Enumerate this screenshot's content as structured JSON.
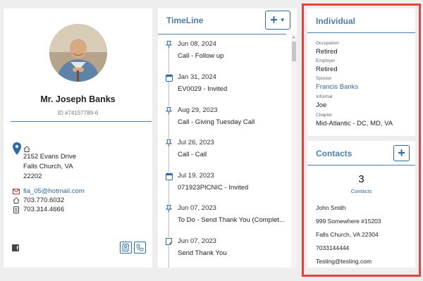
{
  "profile": {
    "name": "Mr. Joseph Banks",
    "id": "ID #74157789-6",
    "address_lines": [
      "2152 Evans Drive",
      "Falls Church, VA",
      "22202"
    ],
    "email": "fia_05@hotmail.com",
    "home_phone": "703.770.6032",
    "mobile_phone": "703.314.4666"
  },
  "timeline": {
    "title": "TimeLine",
    "add_label": "+",
    "items": [
      {
        "icon": "pin-icon",
        "date": "Jun 08, 2024",
        "text": "Call - Follow up"
      },
      {
        "icon": "calendar-icon",
        "date": "Jan 31, 2024",
        "text": "EV0029 - Invited"
      },
      {
        "icon": "pin-icon",
        "date": "Aug 29, 2023",
        "text": "Call - Giving Tuesday Call"
      },
      {
        "icon": "pin-icon",
        "date": "Jul 26, 2023",
        "text": "Call - Call"
      },
      {
        "icon": "calendar-icon",
        "date": "Jul 19, 2023",
        "text": "071923PICNIC - Invited"
      },
      {
        "icon": "pin-icon",
        "date": "Jun 07, 2023",
        "text": "To Do - Send Thank You (Complet..."
      },
      {
        "icon": "note-icon",
        "date": "Jun 07, 2023",
        "text": "Send Thank You"
      }
    ]
  },
  "individual": {
    "title": "Individual",
    "fields": [
      {
        "label": "Occupation",
        "value": "Retired",
        "link": false
      },
      {
        "label": "Employer",
        "value": "Retired",
        "link": false
      },
      {
        "label": "Spouse",
        "value": "Francis Banks",
        "link": true
      },
      {
        "label": "Informal",
        "value": "Joe",
        "link": false
      },
      {
        "label": "Chapter",
        "value": "Mid-Atlantic - DC, MD, VA",
        "link": false
      }
    ]
  },
  "contacts": {
    "title": "Contacts",
    "add_label": "+",
    "count": "3",
    "count_label": "Contacts",
    "lines": [
      "John Smith",
      "999 Somewhere #15203",
      "Falls Church, VA 22304",
      "7033144444",
      "Testing@testing.com"
    ]
  },
  "colors": {
    "accent": "#4a7fb0",
    "link": "#2c6aa6",
    "highlight": "#e8413a"
  }
}
